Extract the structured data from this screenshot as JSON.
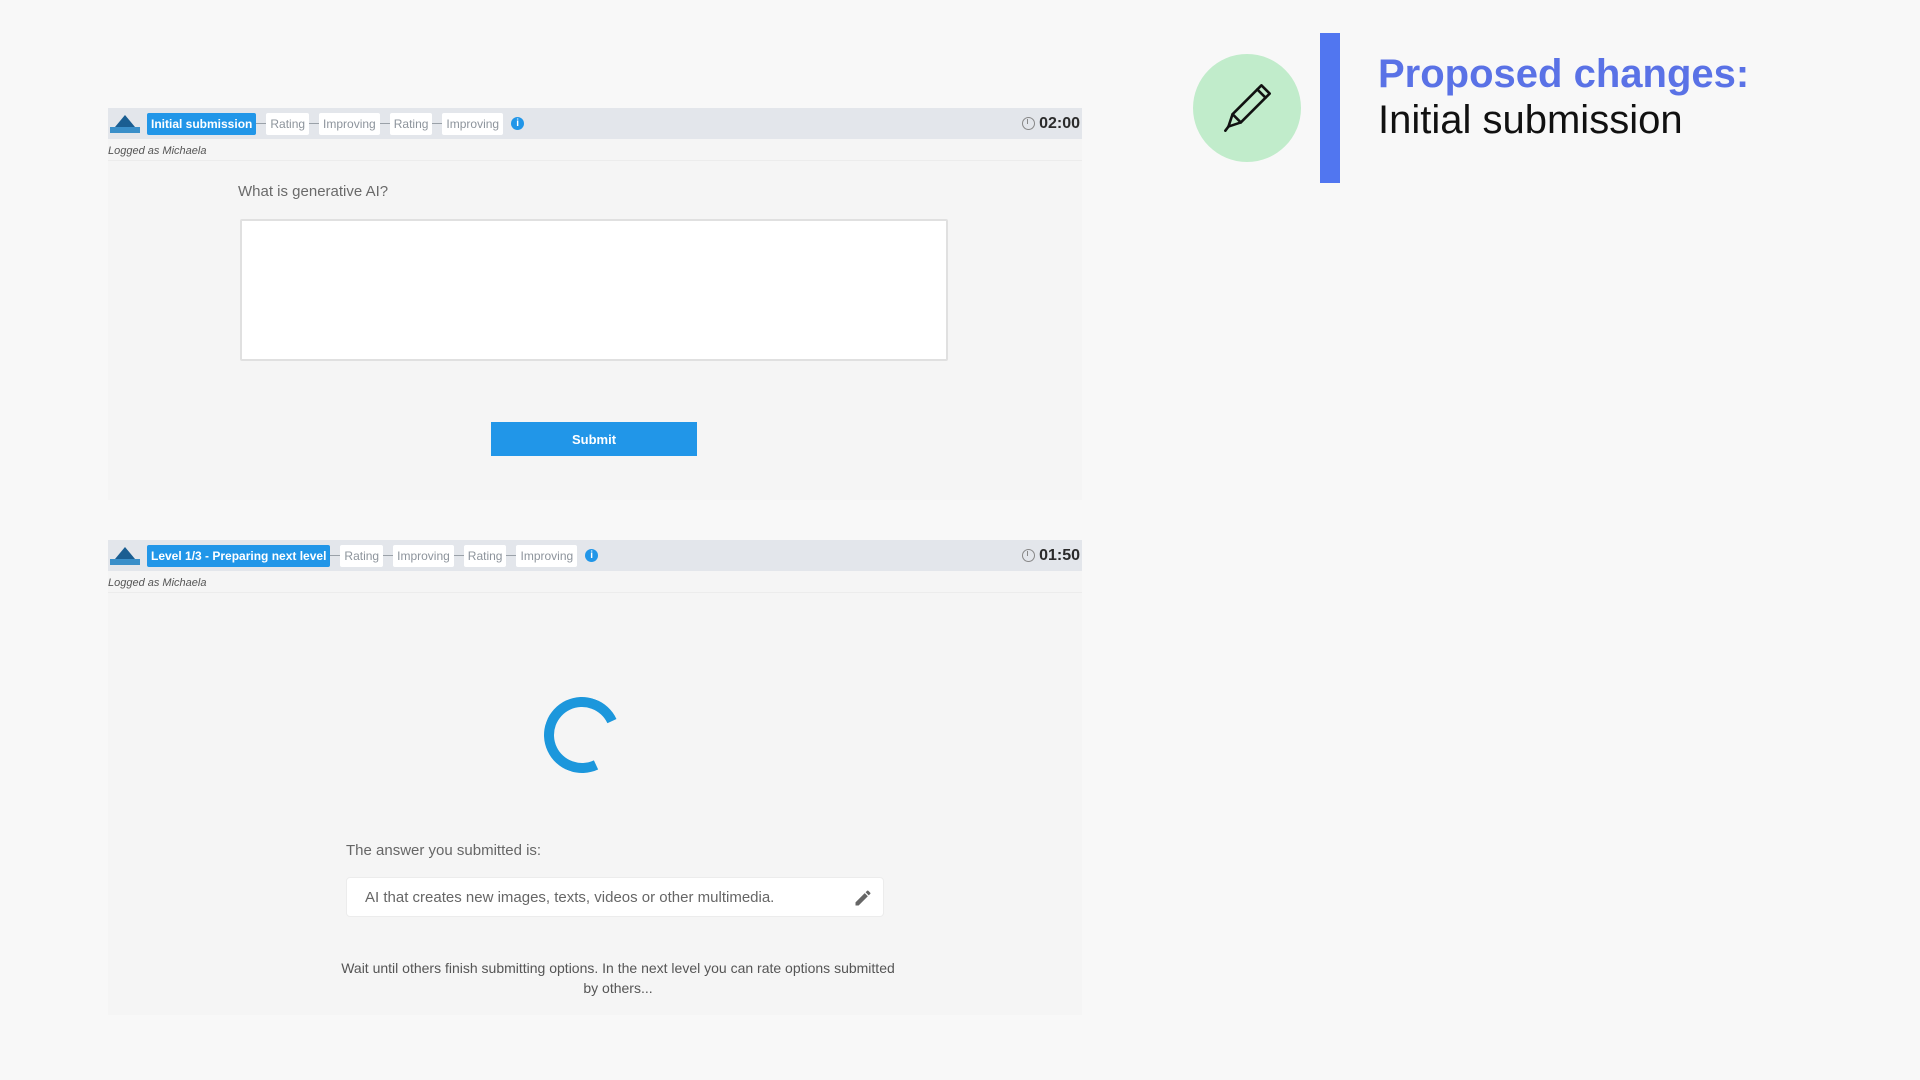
{
  "header": {
    "title_line1": "Proposed changes:",
    "title_line2": "Initial submission",
    "icon": "pencil-icon",
    "accent_color": "#5176f0",
    "icon_bg_color": "#c1eccb"
  },
  "panel1": {
    "steps": [
      "Initial submission",
      "Rating",
      "Improving",
      "Rating",
      "Improving"
    ],
    "active_step": 0,
    "timer": "02:00",
    "logged_as": "Logged as Michaela",
    "question": "What is generative AI?",
    "answer_value": "",
    "submit_label": "Submit"
  },
  "panel2": {
    "steps": [
      "Level 1/3 - Preparing next level",
      "Rating",
      "Improving",
      "Rating",
      "Improving"
    ],
    "active_step": 0,
    "timer": "01:50",
    "logged_as": "Logged as Michaela",
    "submitted_label": "The answer you submitted is:",
    "submitted_answer": "AI that creates new images, texts, videos or other multimedia.",
    "wait_message": "Wait until others finish submitting options. In the next level you can rate options submitted by others..."
  },
  "colors": {
    "primary": "#2196e8",
    "spinner": "#1c97dc"
  }
}
